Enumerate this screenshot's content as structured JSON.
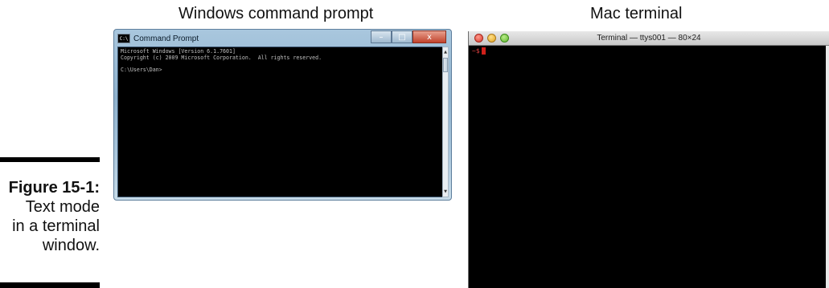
{
  "figure": {
    "headings": {
      "windows": "Windows command prompt",
      "mac": "Mac terminal"
    },
    "caption": {
      "label": "Figure 15-1:",
      "text_lines": [
        "Text mode",
        "in a terminal",
        "window."
      ]
    }
  },
  "windows_window": {
    "title": "Command Prompt",
    "icon": "cmd-icon",
    "console_lines": [
      "Microsoft Windows [Version 6.1.7601]",
      "Copyright (c) 2009 Microsoft Corporation.  All rights reserved.",
      "",
      "C:\\Users\\Dan>"
    ],
    "controls": {
      "minimize": "–",
      "maximize": "□",
      "close": "x"
    }
  },
  "mac_window": {
    "title": "Terminal — ttys001 — 80×24",
    "prompt": "~$"
  },
  "colors": {
    "win_frame": "#8fb2cd",
    "console_bg": "#000000",
    "console_text": "#c0c0c0",
    "mac_prompt": "#e04040",
    "mac_cursor": "#d0201a"
  }
}
